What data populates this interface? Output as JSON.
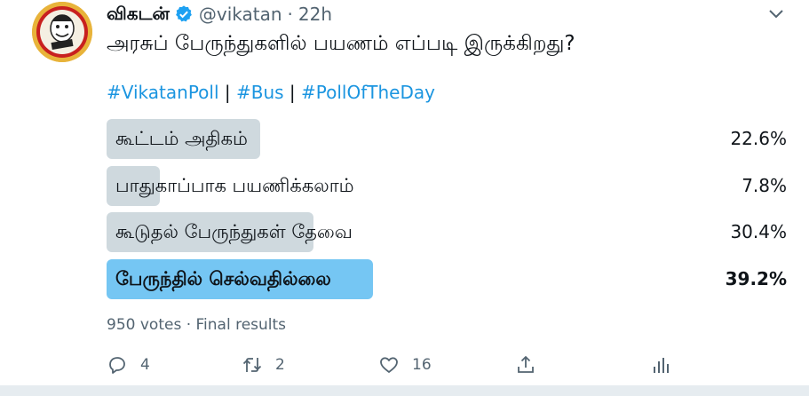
{
  "tweet": {
    "name": "விகடன்",
    "handle": "@vikatan",
    "separator": "·",
    "time": "22h",
    "text": "அரசுப் பேருந்துகளில் பயணம் எப்படி இருக்கிறது?",
    "hashtags": [
      {
        "text": "#VikatanPoll"
      },
      {
        "text": "#Bus"
      },
      {
        "text": "#PollOfTheDay"
      }
    ],
    "hashtag_separator": "|"
  },
  "poll": {
    "options": [
      {
        "label": "கூட்டம் அதிகம்",
        "percent": "22.6%",
        "value": 22.6,
        "winner": false
      },
      {
        "label": "பாதுகாப்பாக பயணிக்கலாம்",
        "percent": "7.8%",
        "value": 7.8,
        "winner": false
      },
      {
        "label": "கூடுதல் பேருந்துகள் தேவை",
        "percent": "30.4%",
        "value": 30.4,
        "winner": false
      },
      {
        "label": "பேருந்தில் செல்வதில்லை",
        "percent": "39.2%",
        "value": 39.2,
        "winner": true
      }
    ],
    "meta": "950 votes · Final results"
  },
  "actions": {
    "reply_count": "4",
    "retweet_count": "2",
    "like_count": "16"
  },
  "colors": {
    "link": "#1b95e0",
    "bar": "#cfd9de",
    "winner_bar": "#75c6f3",
    "verified": "#1da1f2"
  }
}
